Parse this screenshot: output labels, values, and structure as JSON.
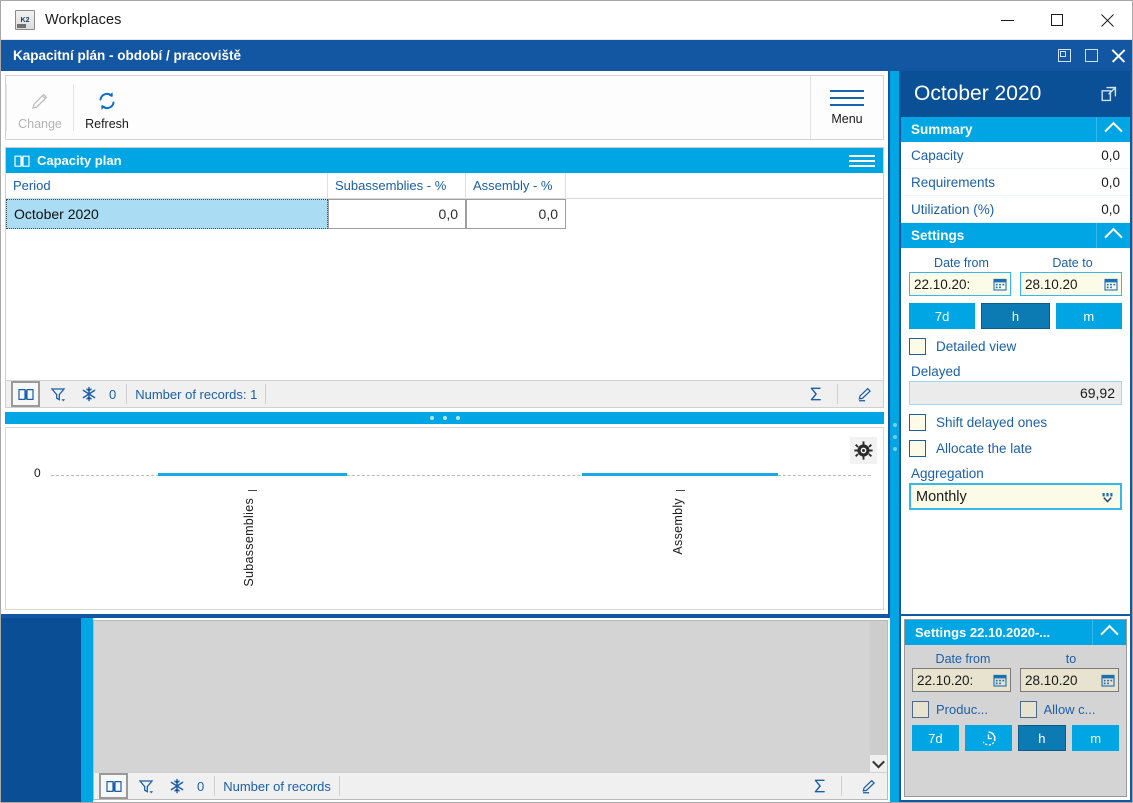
{
  "window": {
    "os_title": "Workplaces",
    "app_icon": "app-icon",
    "minimize": "minimize",
    "maximize": "maximize",
    "close": "close"
  },
  "document": {
    "title": "Kapacitní plán - období / pracoviště",
    "restore_btn": "restore-down",
    "maximize_btn": "maximize",
    "close_btn": "close"
  },
  "ribbon": {
    "change_label": "Change",
    "refresh_label": "Refresh",
    "menu_label": "Menu"
  },
  "grid": {
    "header_title": "Capacity plan",
    "columns": [
      "Period",
      "Subassemblies - %",
      "Assembly - %"
    ],
    "rows": [
      {
        "period": "October 2020",
        "subassemblies": "0,0",
        "assembly": "0,0"
      }
    ],
    "status": {
      "freeze_count": "0",
      "records_text": "Number of records: 1"
    }
  },
  "chart_data": {
    "type": "bar",
    "title": "",
    "categories": [
      "Subassemblies",
      "Assembly"
    ],
    "values": [
      0,
      0
    ],
    "ylabel": "",
    "xlabel": "",
    "ytick_labels": [
      "0"
    ],
    "ylim": [
      0,
      0
    ],
    "grid": true,
    "baseline_style": "dashed",
    "bar_color": "#19a9e8",
    "legend": "none"
  },
  "right_panel": {
    "header_title": "October 2020",
    "summary": {
      "title": "Summary",
      "rows": [
        {
          "label": "Capacity",
          "value": "0,0"
        },
        {
          "label": "Requirements",
          "value": "0,0"
        },
        {
          "label": "Utilization (%)",
          "value": "0,0"
        }
      ]
    },
    "settings": {
      "title": "Settings",
      "date_from_label": "Date from",
      "date_from_value": "22.10.20:",
      "date_to_label": "Date to",
      "date_to_value": "28.10.20",
      "segments": [
        {
          "label": "7d",
          "active": false
        },
        {
          "label": "h",
          "active": true
        },
        {
          "label": "m",
          "active": false
        }
      ],
      "detailed_view_label": "Detailed view",
      "delayed_label": "Delayed",
      "delayed_value": "69,92",
      "shift_delayed_label": "Shift delayed ones",
      "allocate_late_label": "Allocate the late",
      "aggregation_label": "Aggregation",
      "aggregation_value": "Monthly"
    }
  },
  "bottom_right_panel": {
    "title": "Settings 22.10.2020-...",
    "date_from_label": "Date from",
    "date_from_value": "22.10.20:",
    "date_to_label": "to",
    "date_to_value": "28.10.20",
    "check_production_label": "Produc...",
    "check_allow_label": "Allow c...",
    "segments": [
      {
        "label": "7d",
        "active": false,
        "icon": "clock-icon"
      },
      {
        "label": "",
        "active": false,
        "icon": "clock-icon"
      },
      {
        "label": "h",
        "active": true,
        "icon": ""
      },
      {
        "label": "m",
        "active": false,
        "icon": ""
      }
    ]
  },
  "bottom_grid": {
    "status": {
      "freeze_count": "0",
      "records_text": "Number of records"
    }
  },
  "colors": {
    "titlebar_blue": "#1356a2",
    "accent_cyan": "#00a5e4",
    "panel_header_blue": "#0a5096",
    "link_blue": "#1b5fa8",
    "selected_row": "#aadcf4",
    "field_cream": "#fcfbe8",
    "bar_blue": "#19a9e8"
  }
}
